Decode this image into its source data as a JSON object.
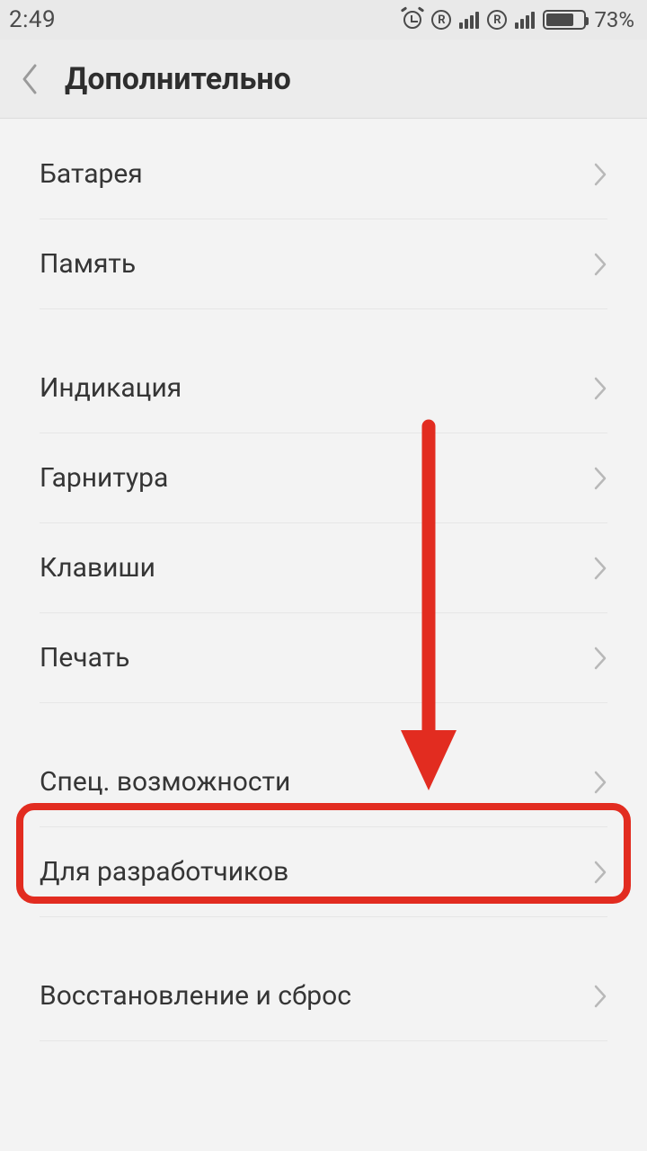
{
  "status": {
    "time": "2:49",
    "sim_badge": "R",
    "battery_pct": "73%"
  },
  "header": {
    "title": "Дополнительно"
  },
  "groups": [
    {
      "items": [
        {
          "label": "Батарея"
        },
        {
          "label": "Память"
        }
      ]
    },
    {
      "items": [
        {
          "label": "Индикация"
        },
        {
          "label": "Гарнитура"
        },
        {
          "label": "Клавиши"
        },
        {
          "label": "Печать"
        }
      ]
    },
    {
      "items": [
        {
          "label": "Спец. возможности"
        },
        {
          "label": "Для разработчиков"
        }
      ]
    },
    {
      "items": [
        {
          "label": "Восстановление и сброс"
        }
      ]
    }
  ],
  "annotation": {
    "highlight_color": "#e22c20"
  }
}
